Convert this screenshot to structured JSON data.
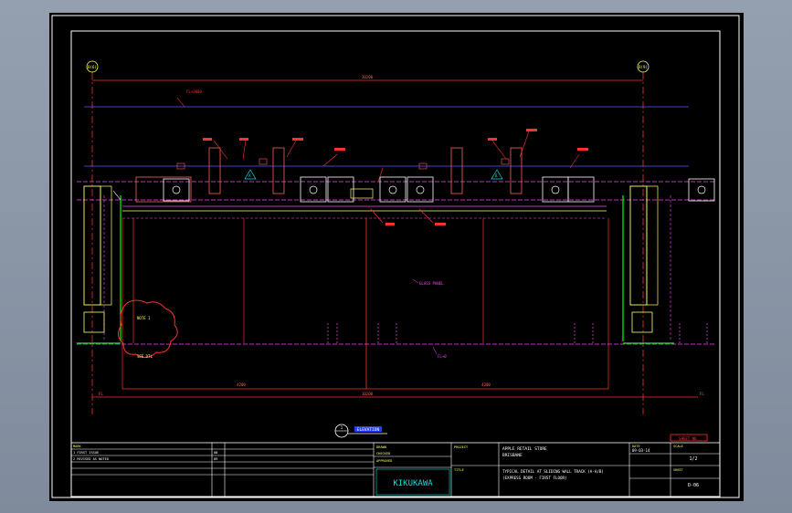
{
  "drawing": {
    "grid_bubbles": [
      "B(6)",
      "B(9)"
    ],
    "dims": {
      "top_overall": "10200",
      "level_upper": "FL+3000",
      "bottom_overall": "10200",
      "left_seg": "4200",
      "right_seg": "4200",
      "left_lvl": "FL",
      "right_lvl": "FL"
    },
    "notes": {
      "cloud_note": "NOTE 1",
      "cloud_note2": "SEE DTL",
      "center_note": "GLASS PANEL",
      "floor_note": "FL+0",
      "tag_A": "A",
      "tag_B": "B"
    },
    "section_title": "ELEVATION",
    "section_no": "1"
  },
  "title_block": {
    "revision_label": "MARK",
    "rev_rows": [
      "1  FIRST ISSUE",
      "2  REVISED AS NOTED"
    ],
    "rev_dates": [
      "08",
      "09"
    ],
    "drawn_by": "DRAWN",
    "checked_by": "CHECKED",
    "approved_by": "APPROVED",
    "company": "KIKUKAWA",
    "project_label": "PROJECT",
    "project_name": "APPLE RETAIL STORE",
    "project_sub": "BRISBANE",
    "title_label": "TITLE",
    "drawing_title_1": "TYPICAL DETAIL AT SLIDING WALL TRACK (A-A/B)",
    "drawing_title_2": "(EXPRESS ROOM - FIRST FLOOR)",
    "date_label": "DATE",
    "date_value": "09-03-14",
    "scale_label": "SCALE",
    "scale_value": "1/2",
    "sheet_label": "SHEET",
    "sheet_value": "D-06",
    "red_stamp": "SHEET NO."
  }
}
